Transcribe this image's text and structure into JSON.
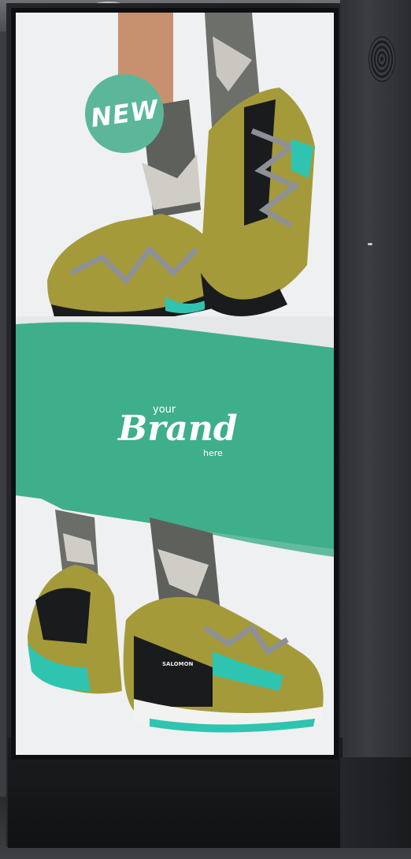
{
  "badge": {
    "text": "NEW"
  },
  "brand": {
    "top": "your",
    "main": "Brand",
    "bottom": "here"
  },
  "shoe": {
    "logo": "SALOMON"
  },
  "colors": {
    "accent_green": "#3fae8b",
    "badge_green": "#5cb79a",
    "shoe_olive": "#a59a3a",
    "sole_teal": "#2fc4b0",
    "kiosk_black": "#1c1d1f"
  }
}
